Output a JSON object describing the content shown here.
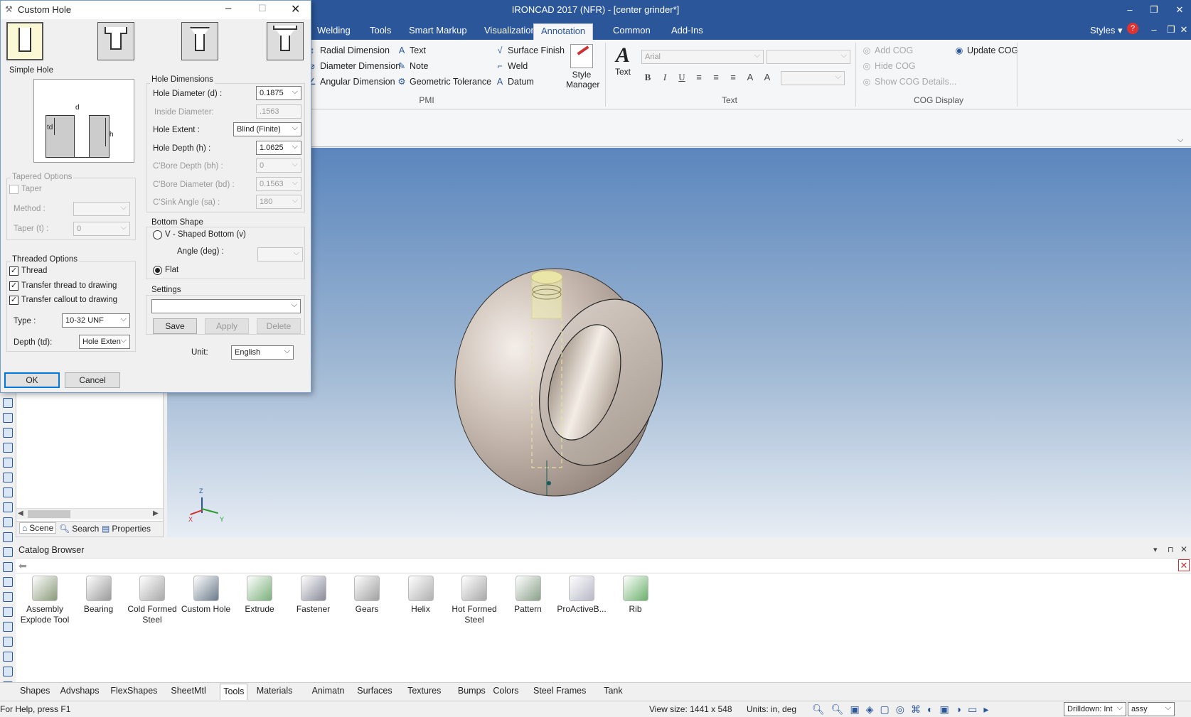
{
  "app": {
    "title": "IRONCAD 2017 (NFR) - [center grinder*]",
    "styles_label": "Styles"
  },
  "ribbon": {
    "tabs": [
      "Welding",
      "Tools",
      "Smart Markup",
      "Visualization",
      "Annotation",
      "Common",
      "Add-Ins"
    ],
    "active_tab": "Annotation",
    "pmi": {
      "group": "PMI",
      "col1": [
        "Radial Dimension",
        "Diameter Dimension",
        "Angular Dimension"
      ],
      "col2": [
        "Text",
        "Note",
        "Geometric Tolerance"
      ],
      "col3": [
        "Surface Finish",
        "Weld",
        "Datum"
      ],
      "style_manager": "Style Manager"
    },
    "text": {
      "group": "Text",
      "big_label": "Text",
      "font": "Arial",
      "glyph": "A"
    },
    "cog": {
      "group": "COG Display",
      "items": [
        "Add COG",
        "Hide COG",
        "Show COG Details..."
      ],
      "update": "Update COG"
    }
  },
  "dialog": {
    "title": "Custom Hole",
    "simple_hole_legend": "Simple Hole",
    "diagram": {
      "d": "d",
      "td": "td",
      "h": "h"
    },
    "tapered": {
      "legend": "Tapered Options",
      "taper": "Taper",
      "method": "Method :",
      "method_value": "",
      "taper_t": "Taper (t) :",
      "taper_t_value": "0"
    },
    "threaded": {
      "legend": "Threaded Options",
      "thread": "Thread",
      "transfer_thread": "Transfer thread to drawing",
      "transfer_callout": "Transfer callout to drawing",
      "type_label": "Type :",
      "type_value": "10-32 UNF",
      "depth_label": "Depth (td):",
      "depth_value": "Hole Exten"
    },
    "dims": {
      "legend": "Hole Dimensions",
      "rows": [
        {
          "label": "Hole Diameter (d) :",
          "value": "0.1875",
          "enabled": true,
          "kind": "combo"
        },
        {
          "label": "Inside Diameter:",
          "value": ".1563",
          "enabled": false,
          "kind": "text"
        },
        {
          "label": "Hole Extent :",
          "value": "Blind (Finite)",
          "enabled": true,
          "kind": "combo"
        },
        {
          "label": "Hole Depth (h) :",
          "value": "1.0625",
          "enabled": true,
          "kind": "combo"
        },
        {
          "label": "C'Bore Depth (bh) :",
          "value": "0",
          "enabled": false,
          "kind": "combo"
        },
        {
          "label": "C'Bore Diameter (bd) :",
          "value": "0.1563",
          "enabled": false,
          "kind": "combo"
        },
        {
          "label": "C'Sink Angle (sa) :",
          "value": "180",
          "enabled": false,
          "kind": "combo"
        }
      ]
    },
    "bottom": {
      "legend": "Bottom Shape",
      "v_shaped": "V - Shaped Bottom (v)",
      "angle": "Angle (deg) :",
      "flat": "Flat"
    },
    "settings": {
      "legend": "Settings",
      "save": "Save",
      "apply": "Apply",
      "delete": "Delete"
    },
    "unit_label": "Unit:",
    "unit_value": "English",
    "ok": "OK",
    "cancel": "Cancel"
  },
  "viewport": {
    "axis": {
      "z": "Z",
      "x": "X",
      "y": "Y"
    }
  },
  "scene_tabs": [
    "Scene",
    "Search",
    "Properties"
  ],
  "catalog": {
    "title": "Catalog Browser",
    "items": [
      {
        "line1": "Assembly",
        "line2": "Explode Tool",
        "color": "#8a9a7a"
      },
      {
        "line1": "Bearing",
        "line2": "",
        "color": "#9a9a9a"
      },
      {
        "line1": "Cold Formed",
        "line2": "Steel",
        "color": "#a8a8a8"
      },
      {
        "line1": "Custom Hole",
        "line2": "",
        "color": "#6a7a8a"
      },
      {
        "line1": "Extrude",
        "line2": "",
        "color": "#7ab07a"
      },
      {
        "line1": "Fastener",
        "line2": "",
        "color": "#8a8a9a"
      },
      {
        "line1": "Gears",
        "line2": "",
        "color": "#a0a0a0"
      },
      {
        "line1": "Helix",
        "line2": "",
        "color": "#b0b0b0"
      },
      {
        "line1": "Hot Formed",
        "line2": "Steel",
        "color": "#a8a8a8"
      },
      {
        "line1": "Pattern",
        "line2": "",
        "color": "#8aa08a"
      },
      {
        "line1": "ProActiveB...",
        "line2": "",
        "color": "#b8b8c8"
      },
      {
        "line1": "Rib",
        "line2": "",
        "color": "#6ab06a"
      }
    ],
    "tabs": [
      "Shapes",
      "Advshaps",
      "FlexShapes",
      "SheetMtl",
      "Tools",
      "Materials",
      "Animatn",
      "Surfaces",
      "Textures",
      "Bumps",
      "Colors",
      "Steel Frames",
      "Tank"
    ],
    "active_tab": "Tools"
  },
  "status": {
    "help": "For Help, press F1",
    "view_size": "View size: 1441 x  548",
    "units": "Units: in, deg",
    "drilldown": "Drilldown: Int",
    "assy": "assy"
  }
}
